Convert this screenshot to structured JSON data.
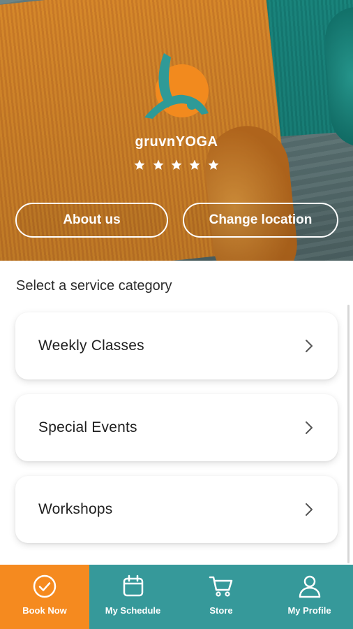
{
  "brand": {
    "name": "gruvnYOGA",
    "rating": 5
  },
  "hero": {
    "about_label": "About us",
    "location_label": "Change location"
  },
  "content": {
    "section_title": "Select a service category",
    "categories": [
      {
        "label": "Weekly Classes"
      },
      {
        "label": "Special Events"
      },
      {
        "label": "Workshops"
      }
    ]
  },
  "nav": {
    "items": [
      {
        "label": "Book Now",
        "icon": "check-circle-icon"
      },
      {
        "label": "My Schedule",
        "icon": "calendar-icon"
      },
      {
        "label": "Store",
        "icon": "cart-icon"
      },
      {
        "label": "My Profile",
        "icon": "person-icon"
      }
    ],
    "active": 0
  },
  "colors": {
    "accent_orange": "#f58a1f",
    "nav_teal": "#36999a"
  }
}
